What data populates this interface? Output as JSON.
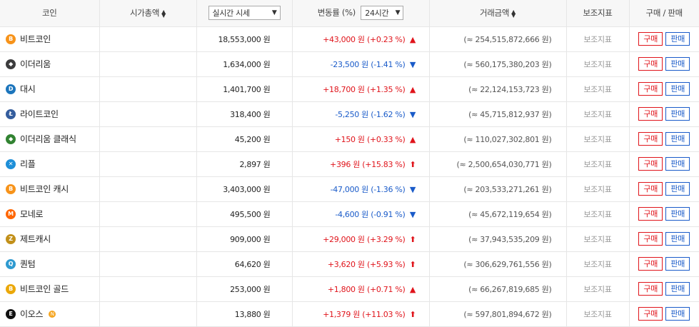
{
  "header": {
    "coin": "코인",
    "market_cap": "시가총액",
    "price_select": "실시간 시세",
    "change": "변동률 (%)",
    "period_select": "24시간",
    "volume": "거래금액",
    "aux": "보조지표",
    "trade": "구매 / 판매"
  },
  "buttons": {
    "buy": "구매",
    "sell": "판매"
  },
  "aux_label": "보조지표",
  "colors": {
    "up": "#e0141b",
    "down": "#1a5bc9"
  },
  "rows": [
    {
      "name": "비트코인",
      "icon": "bitcoin-icon",
      "icon_color": "#f7931a",
      "glyph": "B",
      "price": "18,553,000 원",
      "change": "+43,000 원 (+0.23 %)",
      "dir": "up",
      "ind": "▲",
      "volume": "(≈ 254,515,872,666 원)"
    },
    {
      "name": "이더리움",
      "icon": "ethereum-icon",
      "icon_color": "#3c3c3d",
      "glyph": "◆",
      "price": "1,634,000 원",
      "change": "-23,500 원 (-1.41 %)",
      "dir": "down",
      "ind": "▼",
      "volume": "(≈ 560,175,380,203 원)"
    },
    {
      "name": "대시",
      "icon": "dash-icon",
      "icon_color": "#1c75bc",
      "glyph": "D",
      "price": "1,401,700 원",
      "change": "+18,700 원 (+1.35 %)",
      "dir": "up",
      "ind": "▲",
      "volume": "(≈ 22,124,153,723 원)"
    },
    {
      "name": "라이트코인",
      "icon": "litecoin-icon",
      "icon_color": "#345d9d",
      "glyph": "Ł",
      "price": "318,400 원",
      "change": "-5,250 원 (-1.62 %)",
      "dir": "down",
      "ind": "▼",
      "volume": "(≈ 45,715,812,937 원)"
    },
    {
      "name": "이더리움 클래식",
      "icon": "ethereum-classic-icon",
      "icon_color": "#328332",
      "glyph": "◆",
      "price": "45,200 원",
      "change": "+150 원 (+0.33 %)",
      "dir": "up",
      "ind": "▲",
      "volume": "(≈ 110,027,302,801 원)"
    },
    {
      "name": "리플",
      "icon": "ripple-icon",
      "icon_color": "#1e8fd8",
      "glyph": "✕",
      "price": "2,897 원",
      "change": "+396 원 (+15.83 %)",
      "dir": "up",
      "ind": "⬆",
      "volume": "(≈ 2,500,654,030,771 원)"
    },
    {
      "name": "비트코인 캐시",
      "icon": "bitcoin-cash-icon",
      "icon_color": "#f7931a",
      "glyph": "B",
      "price": "3,403,000 원",
      "change": "-47,000 원 (-1.36 %)",
      "dir": "down",
      "ind": "▼",
      "volume": "(≈ 203,533,271,261 원)"
    },
    {
      "name": "모네로",
      "icon": "monero-icon",
      "icon_color": "#ff6600",
      "glyph": "M",
      "price": "495,500 원",
      "change": "-4,600 원 (-0.91 %)",
      "dir": "down",
      "ind": "▼",
      "volume": "(≈ 45,672,119,654 원)"
    },
    {
      "name": "제트캐시",
      "icon": "zcash-icon",
      "icon_color": "#c2901a",
      "glyph": "Z",
      "price": "909,000 원",
      "change": "+29,000 원 (+3.29 %)",
      "dir": "up",
      "ind": "⬆",
      "volume": "(≈ 37,943,535,209 원)"
    },
    {
      "name": "퀀텀",
      "icon": "qtum-icon",
      "icon_color": "#2e9ad0",
      "glyph": "Q",
      "price": "64,620 원",
      "change": "+3,620 원 (+5.93 %)",
      "dir": "up",
      "ind": "⬆",
      "volume": "(≈ 306,629,761,556 원)"
    },
    {
      "name": "비트코인 골드",
      "icon": "bitcoin-gold-icon",
      "icon_color": "#eba809",
      "glyph": "B",
      "price": "253,000 원",
      "change": "+1,800 원 (+0.71 %)",
      "dir": "up",
      "ind": "▲",
      "volume": "(≈ 66,267,819,685 원)"
    },
    {
      "name": "이오스",
      "icon": "eos-icon",
      "icon_color": "#111111",
      "glyph": "E",
      "price": "13,880 원",
      "change": "+1,379 원 (+11.03 %)",
      "dir": "up",
      "ind": "⬆",
      "volume": "(≈ 597,801,894,672 원)",
      "new_badge": "N"
    }
  ]
}
